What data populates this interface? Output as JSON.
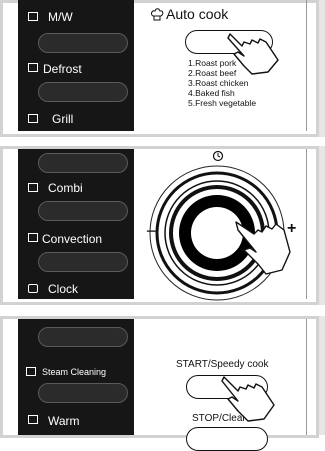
{
  "panel1": {
    "buttons": [
      {
        "label": "M/W",
        "icon": "microwave-icon"
      },
      {
        "label": "Defrost",
        "icon": "defrost-icon"
      },
      {
        "label": "Grill",
        "icon": "grill-icon"
      }
    ],
    "auto_cook": {
      "title": "Auto cook",
      "icon": "chef-hat-icon",
      "items": [
        "1.Roast pork",
        "2.Roast beef",
        "3.Roast chicken",
        "4.Baked fish",
        "5.Fresh vegetable"
      ]
    }
  },
  "panel2": {
    "buttons": [
      {
        "label": "Combi",
        "icon": "combi-icon"
      },
      {
        "label": "Convection",
        "icon": "convection-icon"
      },
      {
        "label": "Clock",
        "icon": "clock-icon"
      }
    ],
    "dial": {
      "minus": "−",
      "plus": "+",
      "top_icon": "timer-icon"
    }
  },
  "panel3": {
    "buttons": [
      {
        "label": "Steam Cleaning",
        "icon": "steam-icon"
      },
      {
        "label": "Warm",
        "icon": "warm-icon"
      }
    ],
    "start_label": "START/Speedy cook",
    "stop_label": "STOP/Clear"
  }
}
